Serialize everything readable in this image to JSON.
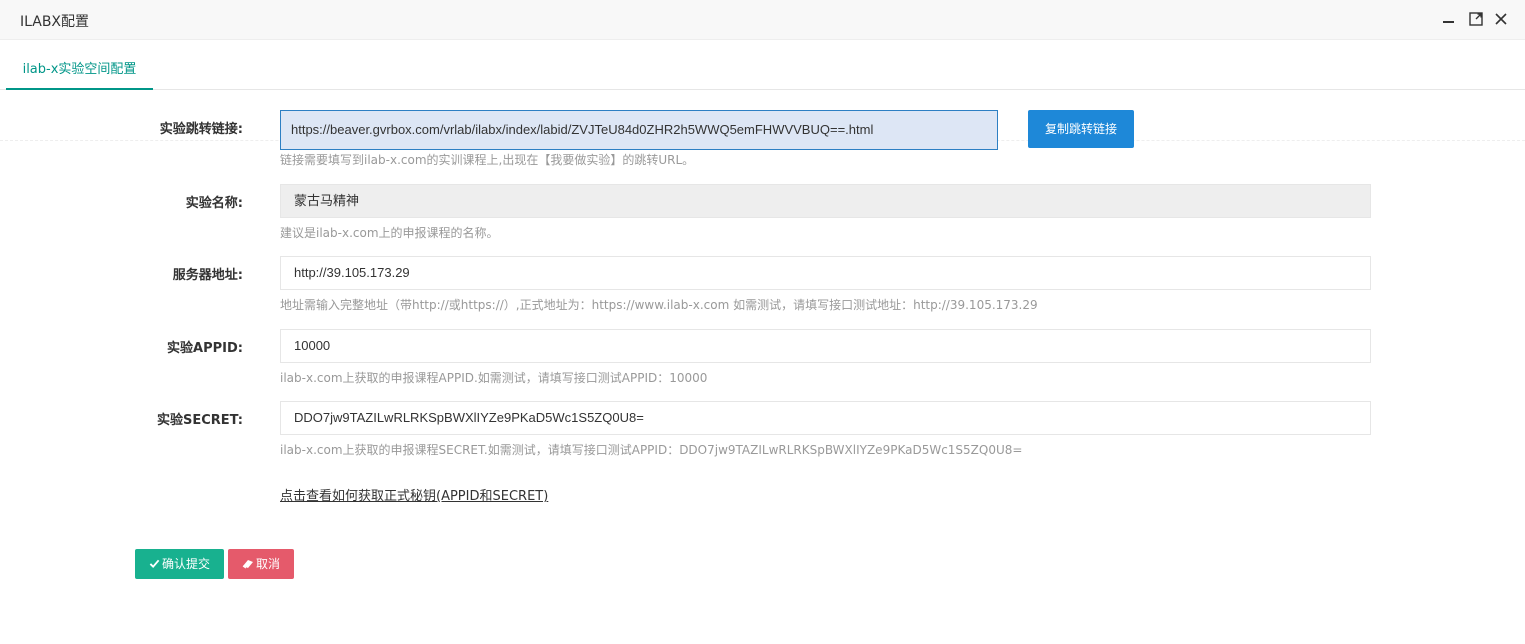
{
  "window": {
    "title": "ILABX配置"
  },
  "tabs": [
    {
      "label": "ilab-x实验空间配置"
    }
  ],
  "form": {
    "jump_link": {
      "label": "实验跳转链接:",
      "value": "https://beaver.gvrbox.com/vrlab/ilabx/index/labid/ZVJTeU84d0ZHR2h5WWQ5emFHWVVBUQ==.html",
      "help": "链接需要填写到ilab-x.com的实训课程上,出现在【我要做实验】的跳转URL。",
      "copy_button": "复制跳转链接"
    },
    "experiment_name": {
      "label": "实验名称:",
      "value": "蒙古马精神",
      "help": "建议是ilab-x.com上的申报课程的名称。"
    },
    "server_address": {
      "label": "服务器地址:",
      "value": "http://39.105.173.29",
      "help": "地址需输入完整地址（带http://或https://）,正式地址为：https://www.ilab-x.com 如需测试，请填写接口测试地址：http://39.105.173.29"
    },
    "appid": {
      "label": "实验APPID:",
      "value": "10000",
      "help": "ilab-x.com上获取的申报课程APPID.如需测试，请填写接口测试APPID：10000"
    },
    "secret": {
      "label": "实验SECRET:",
      "value": "DDO7jw9TAZILwRLRKSpBWXlIYZe9PKaD5Wc1S5ZQ0U8=",
      "help": "ilab-x.com上获取的申报课程SECRET.如需测试，请填写接口测试APPID：DDO7jw9TAZILwRLRKSpBWXlIYZe9PKaD5Wc1S5ZQ0U8="
    },
    "help_link": "点击查看如何获取正式秘钥(APPID和SECRET)"
  },
  "actions": {
    "submit": "确认提交",
    "cancel": "取消"
  },
  "colors": {
    "accent": "#009688",
    "submit": "#18b18f",
    "cancel": "#e55a6b",
    "copy": "#1e88d8"
  }
}
